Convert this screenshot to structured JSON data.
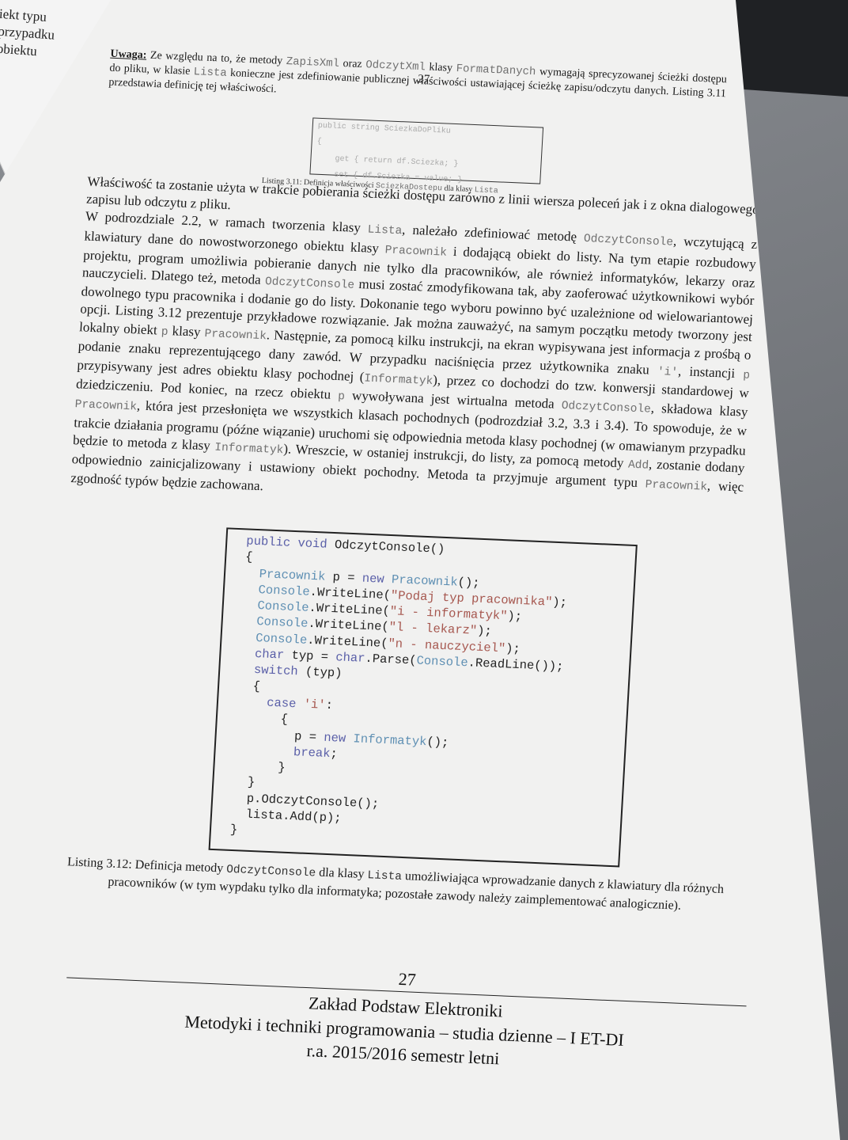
{
  "background_sheet": {
    "text": "iekt typu\nprzypadku\nobiektu"
  },
  "page": {
    "header_number": "27",
    "note": {
      "label": "Uwaga:",
      "t1": "Ze względu na to, że metody ",
      "c1": "ZapisXml",
      "t2": " oraz ",
      "c2": "OdczytXml",
      "t3": " klasy ",
      "c3": "FormatDanych",
      "t4": " wymagają sprecyzowanej ścieżki dostępu do pliku, w klasie ",
      "c4": "Lista",
      "t5": " konieczne jest zdefiniowanie publicznej właściwości ustawiającej ścieżkę zapisu/odczytu danych. Listing 3.11 przedstawia definicję tej właściwości."
    },
    "mini_listing": {
      "lines": [
        "public string SciezkaDoPliku",
        "{",
        "    get { return df.Sciezka; }",
        "    set { df.Sciezka = value; }",
        "}"
      ],
      "caption_pre": "Listing 3.11: Definicja właściwości ",
      "caption_code": "SciezkaDostepu",
      "caption_mid": " dla klasy ",
      "caption_code2": "Lista"
    },
    "body": {
      "p1": "Właściwość ta zostanie użyta w trakcie pobierania ścieżki dostępu zarówno z linii wiersza poleceń jak i z okna dialogowego zapisu lub odczytu z pliku.",
      "p2a": "W podrozdziale 2.2, w ramach tworzenia klasy ",
      "p2c1": "Lista",
      "p2b": ", należało zdefiniować metodę ",
      "p2c2": "OdczytConsole",
      "p2c": ", wczytującą z klawiatury dane do nowostworzonego obiektu klasy ",
      "p2c3": "Pracownik",
      "p2d": " i dodającą obiekt do listy. Na tym etapie rozbudowy projektu, program umożliwia pobieranie danych nie tylko dla pracowników, ale również informatyków, lekarzy oraz nauczycieli. Dlatego też, metoda ",
      "p2c4": "OdczytConsole",
      "p2e": " musi zostać zmodyfikowana tak, aby zaoferować użytkownikowi wybór dowolnego typu pracownika i dodanie go do listy. Dokonanie tego wyboru powinno być uzależnione od wielowariantowej opcji. Listing 3.12 prezentuje przykładowe rozwiązanie. Jak można zauważyć, na samym początku metody tworzony jest lokalny obiekt ",
      "p2c5": "p",
      "p2f": " klasy ",
      "p2c6": "Pracownik",
      "p2g": ". Następnie, za pomocą kilku instrukcji, na ekran wypisywana jest informacja z prośbą o podanie znaku reprezentującego dany zawód. W przypadku naciśnięcia przez użytkownika znaku ",
      "p2c7": "'i'",
      "p2h": ", instancji ",
      "p2c8": "p",
      "p2i": " przypisywany jest adres obiektu klasy pochodnej (",
      "p2c9": "Informatyk",
      "p2j": "), przez co dochodzi do tzw. konwersji standardowej w dziedziczeniu. Pod koniec, na rzecz obiektu ",
      "p2c10": "p",
      "p2k": " wywoływana jest wirtualna metoda ",
      "p2c11": "OdczytConsole",
      "p2l": ", składowa klasy ",
      "p2c12": "Pracownik",
      "p2m": ", która jest przesłonięta we wszystkich klasach pochodnych (podrozdział 3.2, 3.3 i 3.4). To spowoduje, że w trakcie działania programu (późne wiązanie) uruchomi się odpowiednia metoda klasy pochodnej (w omawianym przypadku będzie to metoda z klasy ",
      "p2c13": "Informatyk",
      "p2n": "). Wreszcie, w ostaniej instrukcji, do listy, za pomocą metody ",
      "p2c14": "Add",
      "p2o": ", zostanie dodany odpowiednio zainicjalizowany i ustawiony obiekt pochodny. Metoda ta przyjmuje argument typu ",
      "p2c15": "Pracownik",
      "p2p": ", więc zgodność typów będzie zachowana."
    },
    "listing": {
      "l1_kw": "public void",
      "l1_rest": " OdczytConsole()",
      "l2": "{",
      "l3_ty": "Pracownik",
      "l3_a": " p = ",
      "l3_kw": "new",
      "l3_ty2": "Pracownik",
      "l3_b": "();",
      "wl_ty": "Console",
      "wl_fn": ".WriteLine(",
      "l4_str": "\"Podaj typ pracownika\"",
      "l5_str": "\"i - informatyk\"",
      "l6_str": "\"l - lekarz\"",
      "l7_str": "\"n - nauczyciel\"",
      "wl_end": ");",
      "l8_kw": "char",
      "l8_a": " typ = ",
      "l8_kw2": "char",
      "l8_b": ".Parse(",
      "l8_ty": "Console",
      "l8_c": ".ReadLine());",
      "l9_kw": "switch",
      "l9_rest": " (typ)",
      "l10": "{",
      "l11_kw": "case",
      "l11_str": "'i'",
      "l11_rest": ":",
      "l12": "{",
      "l13_a": "p = ",
      "l13_kw": "new",
      "l13_ty": "Informatyk",
      "l13_b": "();",
      "l14_kw": "break",
      "l14_rest": ";",
      "l15": "}",
      "l16": "}",
      "l17": "p.OdczytConsole();",
      "l18": "lista.Add(p);",
      "l19": "}"
    },
    "caption": {
      "a": "Listing 3.12: Definicja metody ",
      "c1": "OdczytConsole",
      "b": " dla klasy ",
      "c2": "Lista",
      "c": " umożliwiająca wprowadzanie danych z klawiatury dla różnych pracowników (w tym wypdaku tylko dla informatyka; pozostałe zawody należy zaimplementować analogicznie)."
    },
    "footer": {
      "page_number": "27",
      "line1": "Zakład Podstaw Elektroniki",
      "line2": "Metodyki i techniki programowania – studia dzienne – I ET-DI",
      "line3": "r.a. 2015/2016 semestr letni"
    }
  }
}
